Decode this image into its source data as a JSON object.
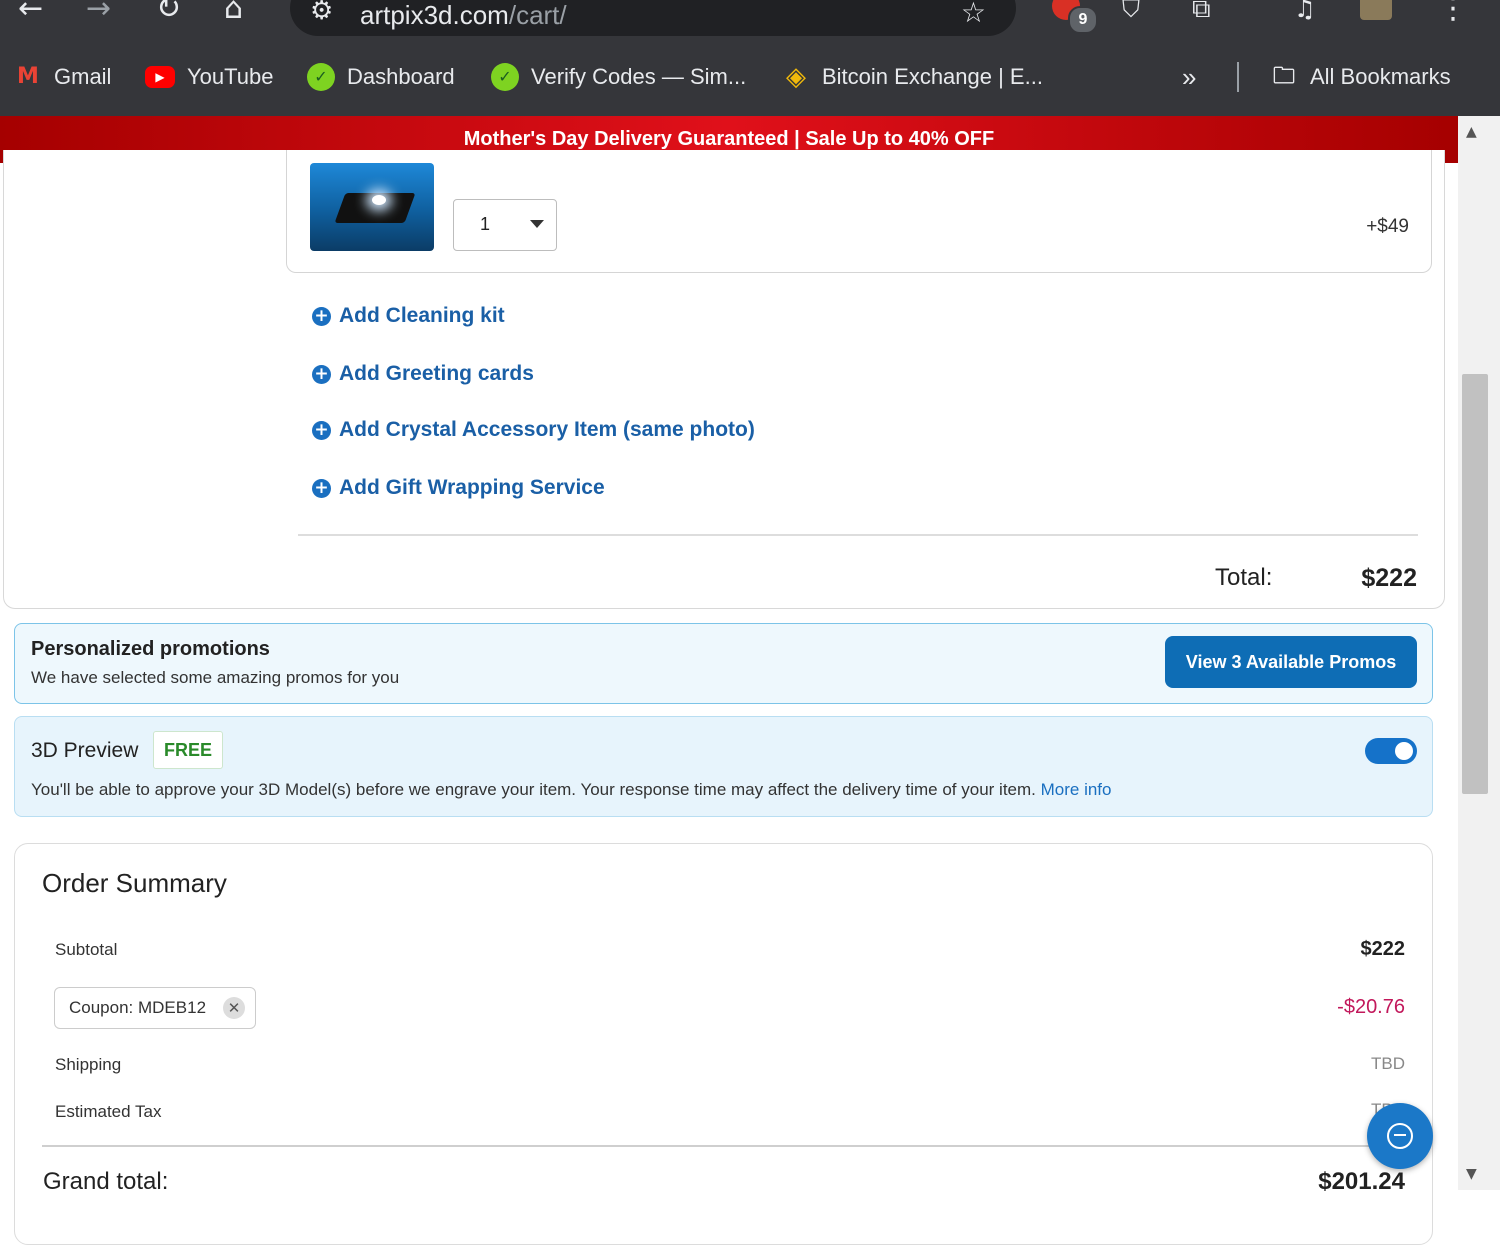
{
  "browser": {
    "url_host": "artpix3d.com",
    "url_path": "/cart/",
    "extension_badge_count": "9",
    "bookmarks": [
      {
        "label": "Gmail",
        "icon": "gmail-icon"
      },
      {
        "label": "YouTube",
        "icon": "youtube-icon"
      },
      {
        "label": "Dashboard",
        "icon": "dashboard-icon"
      },
      {
        "label": "Verify Codes — Sim...",
        "icon": "verify-icon"
      },
      {
        "label": "Bitcoin Exchange | E...",
        "icon": "binance-icon"
      }
    ],
    "overflow_label": "»",
    "all_bookmarks_label": "All Bookmarks"
  },
  "banner": {
    "text": "Mother's Day Delivery Guaranteed | Sale Up to 40% OFF"
  },
  "cart": {
    "quantity": "1",
    "addon_price": "+$49",
    "addons": [
      "Add Cleaning kit",
      "Add Greeting cards",
      "Add Crystal Accessory Item (same photo)",
      "Add Gift Wrapping Service"
    ],
    "total_label": "Total:",
    "total_value": "$222"
  },
  "promotions": {
    "title": "Personalized promotions",
    "subtitle": "We have selected some amazing promos for you",
    "button_label": "View 3 Available Promos"
  },
  "preview": {
    "title": "3D Preview",
    "badge": "FREE",
    "enabled": true,
    "description": "You'll be able to approve your 3D Model(s) before we engrave your item. Your response time may affect the delivery time of your item.",
    "more_info_label": "More info"
  },
  "order_summary": {
    "title": "Order Summary",
    "subtotal_label": "Subtotal",
    "subtotal_value": "$222",
    "coupon_label": "Coupon: MDEB12",
    "coupon_value": "-$20.76",
    "shipping_label": "Shipping",
    "shipping_value": "TBD",
    "tax_label": "Estimated Tax",
    "tax_value": "TBD",
    "grand_total_label": "Grand total:",
    "grand_total_value": "$201.24"
  },
  "colors": {
    "banner_red": "#e0101a",
    "link_blue": "#1a5fa6",
    "discount_red": "#c2185b",
    "button_blue": "#0e6db5"
  }
}
